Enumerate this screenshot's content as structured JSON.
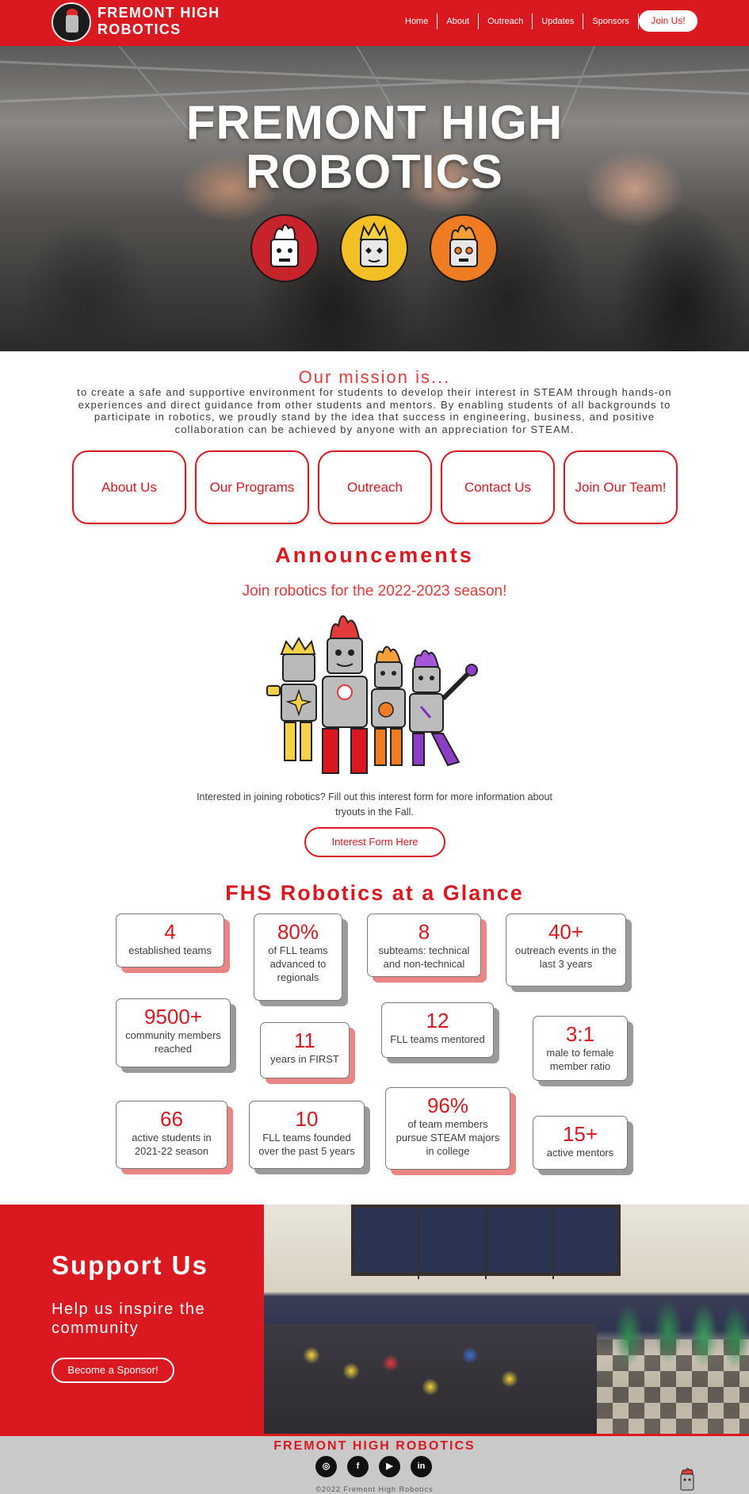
{
  "header": {
    "brand_line1": "FREMONT HIGH",
    "brand_line2": "ROBOTICS",
    "nav": [
      "Home",
      "About",
      "Outreach",
      "Updates",
      "Sponsors"
    ],
    "join_label": "Join Us!"
  },
  "hero": {
    "title_line1": "FREMONT HIGH",
    "title_line2": "ROBOTICS"
  },
  "mission": {
    "title": "Our mission is...",
    "text": "to create a safe and supportive environment for students to develop their interest in STEAM through hands-on experiences and direct guidance from other students and mentors. By enabling students of all backgrounds to participate in robotics, we proudly stand by the idea that success in engineering, business, and positive collaboration can be achieved by anyone with an appreciation for STEAM."
  },
  "quick_links": [
    "About Us",
    "Our Programs",
    "Outreach",
    "Contact Us",
    "Join Our Team!"
  ],
  "announcements": {
    "title": "Announcements",
    "subtitle": "Join robotics for the 2022-2023 season!",
    "text": "Interested in joining robotics? Fill out this interest form for more information about tryouts in the Fall.",
    "button": "Interest Form Here"
  },
  "glance": {
    "title": "FHS Robotics at a Glance",
    "stats": [
      {
        "num": "4",
        "label": "established teams"
      },
      {
        "num": "80%",
        "label": "of FLL teams advanced to regionals"
      },
      {
        "num": "8",
        "label": "subteams: technical and non-technical"
      },
      {
        "num": "40+",
        "label": "outreach events in the last 3 years"
      },
      {
        "num": "9500+",
        "label": "community members reached"
      },
      {
        "num": "11",
        "label": "years in FIRST"
      },
      {
        "num": "12",
        "label": "FLL teams mentored"
      },
      {
        "num": "3:1",
        "label": "male to female member ratio"
      },
      {
        "num": "66",
        "label": "active students in 2021-22 season"
      },
      {
        "num": "10",
        "label": "FLL teams founded over the past 5 years"
      },
      {
        "num": "96%",
        "label": "of team members pursue STEAM majors in college"
      },
      {
        "num": "15+",
        "label": "active mentors"
      }
    ]
  },
  "support": {
    "title": "Support Us",
    "subtitle": "Help us inspire the community",
    "button": "Become a Sponsor!"
  },
  "footer": {
    "title": "FREMONT HIGH ROBOTICS",
    "socials": [
      "instagram-icon",
      "facebook-icon",
      "youtube-icon",
      "linkedin-icon"
    ],
    "social_glyphs": [
      "◎",
      "f",
      "▶",
      "in"
    ],
    "copyright": "©2022 Fremont High Robotics"
  },
  "colors": {
    "brand_red": "#d9191f",
    "light_red": "#e33b3b",
    "shadow_red": "#e98582",
    "shadow_gray": "#9a9a9a"
  }
}
